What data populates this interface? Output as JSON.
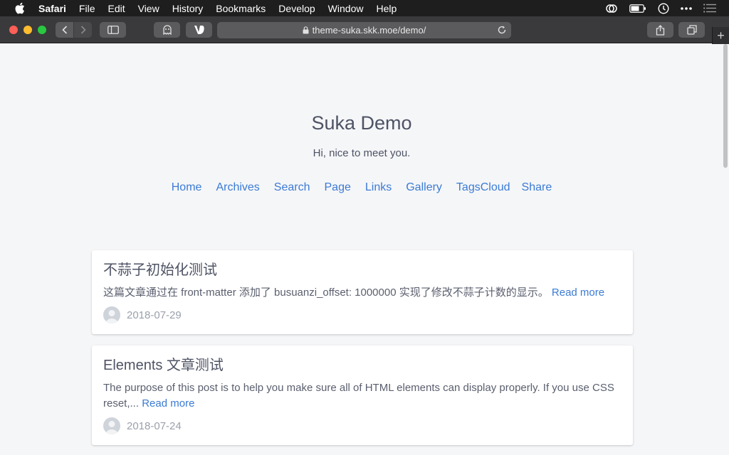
{
  "menubar": {
    "app": "Safari",
    "items": [
      "File",
      "Edit",
      "View",
      "History",
      "Bookmarks",
      "Develop",
      "Window",
      "Help"
    ],
    "status_icons": [
      "creative-cloud-icon",
      "battery-icon",
      "time-machine-icon",
      "more-icon",
      "notification-center-icon"
    ]
  },
  "browser": {
    "url": "theme-suka.skk.moe/demo/",
    "new_tab_label": "+"
  },
  "site": {
    "title": "Suka Demo",
    "subtitle": "Hi, nice to meet you.",
    "nav": [
      "Home",
      "Archives",
      "Search",
      "Page",
      "Links",
      "Gallery",
      "TagsCloud",
      "Share"
    ],
    "accent_color": "#3b7bd4"
  },
  "posts": [
    {
      "title": "不蒜子初始化测试",
      "excerpt": "这篇文章通过在 front-matter 添加了 busuanzi_offset: 1000000 实现了修改不蒜子计数的显示。",
      "read_more": "Read more",
      "date": "2018-07-29"
    },
    {
      "title": "Elements 文章测试",
      "excerpt": "The purpose of this post is to help you make sure all of HTML elements can display properly. If you use CSS reset,...",
      "read_more": "Read more",
      "date": "2018-07-24"
    }
  ]
}
